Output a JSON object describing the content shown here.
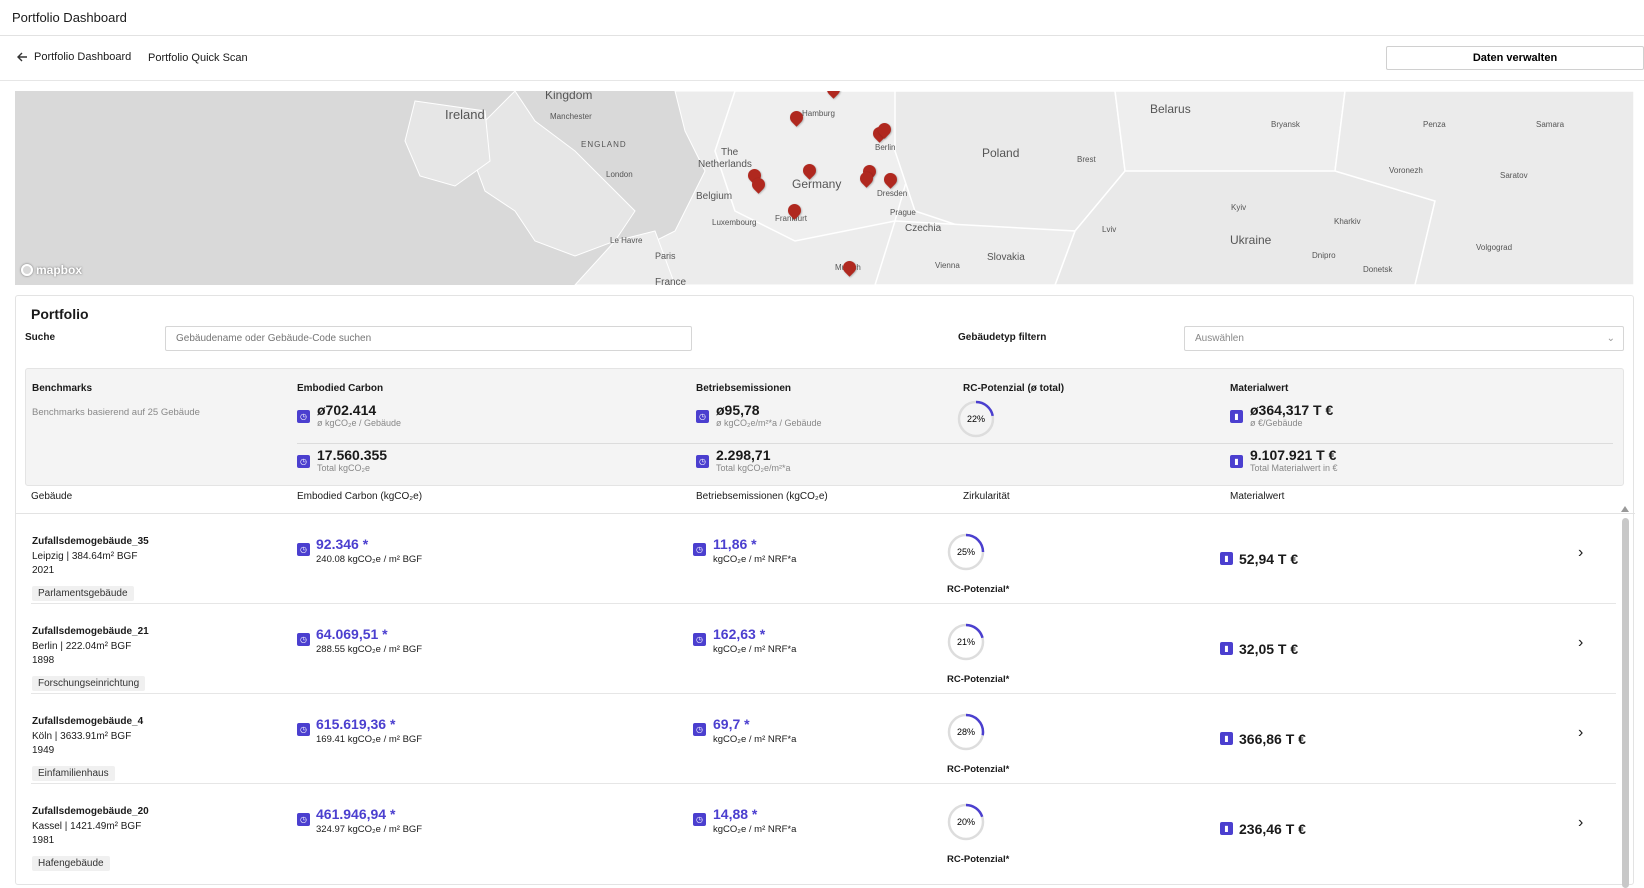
{
  "app": {
    "title": "Portfolio Dashboard"
  },
  "subnav": {
    "back_label": "Portfolio Dashboard",
    "quick_scan": "Portfolio Quick Scan",
    "manage_button": "Daten verwalten"
  },
  "map": {
    "labels": [
      {
        "text": "Kingdom",
        "size": "big"
      },
      {
        "text": "Ireland",
        "size": "big"
      },
      {
        "text": "Manchester",
        "size": "small"
      },
      {
        "text": "ENGLAND",
        "size": "small"
      },
      {
        "text": "London",
        "size": "small"
      },
      {
        "text": "The",
        "size": "mid"
      },
      {
        "text": "Netherlands",
        "size": "mid"
      },
      {
        "text": "Belgium",
        "size": "mid"
      },
      {
        "text": "Luxembourg",
        "size": "small"
      },
      {
        "text": "Le Havre",
        "size": "small"
      },
      {
        "text": "Paris",
        "size": "small"
      },
      {
        "text": "Germany",
        "size": "big"
      },
      {
        "text": "Hamburg",
        "size": "small"
      },
      {
        "text": "Berlin",
        "size": "small"
      },
      {
        "text": "Dresden",
        "size": "small"
      },
      {
        "text": "Frankfurt",
        "size": "small"
      },
      {
        "text": "Prague",
        "size": "small"
      },
      {
        "text": "Czechia",
        "size": "mid"
      },
      {
        "text": "Munich",
        "size": "small"
      },
      {
        "text": "Vienna",
        "size": "small"
      },
      {
        "text": "Slovakia",
        "size": "mid"
      },
      {
        "text": "Poland",
        "size": "big"
      },
      {
        "text": "Brest",
        "size": "small"
      },
      {
        "text": "Belarus",
        "size": "big"
      },
      {
        "text": "Bryansk",
        "size": "small"
      },
      {
        "text": "Penza",
        "size": "small"
      },
      {
        "text": "Samara",
        "size": "small"
      },
      {
        "text": "Voronezh",
        "size": "small"
      },
      {
        "text": "Saratov",
        "size": "small"
      },
      {
        "text": "Kyiv",
        "size": "small"
      },
      {
        "text": "Kharkiv",
        "size": "small"
      },
      {
        "text": "Ukraine",
        "size": "big"
      },
      {
        "text": "Volgograd",
        "size": "small"
      },
      {
        "text": "Dnipro",
        "size": "small"
      },
      {
        "text": "Donetsk",
        "size": "small"
      },
      {
        "text": "Lviv",
        "size": "small"
      },
      {
        "text": "France",
        "size": "mid"
      }
    ],
    "attribution": "mapbox"
  },
  "portfolio": {
    "title": "Portfolio",
    "search_label": "Suche",
    "search_placeholder": "Gebäudename oder Gebäude-Code suchen",
    "filter_label": "Gebäudetyp filtern",
    "filter_placeholder": "Auswählen"
  },
  "benchmarks": {
    "title": "Benchmarks",
    "subtitle": "Benchmarks basierend auf 25 Gebäude",
    "embodied": {
      "title": "Embodied Carbon",
      "avg_value": "ø702.414",
      "avg_caption": "ø kgCO₂e / Gebäude",
      "total_value": "17.560.355",
      "total_caption": "Total kgCO₂e"
    },
    "operational": {
      "title": "Betriebsemissionen",
      "avg_value": "ø95,78",
      "avg_caption": "ø kgCO₂e/m²*a / Gebäude",
      "total_value": "2.298,71",
      "total_caption": "Total kgCO₂e/m²*a"
    },
    "rc": {
      "title": "RC-Potenzial (ø total)",
      "value": "22%",
      "fraction": 0.22
    },
    "material": {
      "title": "Materialwert",
      "avg_value": "ø364,317 T €",
      "avg_caption": "ø €/Gebäude",
      "total_value": "9.107.921 T €",
      "total_caption": "Total Materialwert in €"
    }
  },
  "columns": [
    "Gebäude",
    "Embodied Carbon (kgCO₂e)",
    "Betriebsemissionen (kgCO₂e)",
    "Zirkularität",
    "Materialwert"
  ],
  "rows": [
    {
      "name": "Zufallsdemogebäude_35",
      "location": "Leipzig | 384.64m² BGF",
      "year": "2021",
      "tag": "Parlamentsgebäude",
      "ec_value": "92.346 *",
      "ec_sub": "240.08 kgCO₂e / m² BGF",
      "be_value": "11,86 *",
      "be_sub": "kgCO₂e / m² NRF*a",
      "rc_pct": "25%",
      "rc_fraction": 0.25,
      "rc_label": "RC-Potenzial*",
      "material": "52,94 T €"
    },
    {
      "name": "Zufallsdemogebäude_21",
      "location": "Berlin | 222.04m² BGF",
      "year": "1898",
      "tag": "Forschungseinrichtung",
      "ec_value": "64.069,51 *",
      "ec_sub": "288.55 kgCO₂e / m² BGF",
      "be_value": "162,63 *",
      "be_sub": "kgCO₂e / m² NRF*a",
      "rc_pct": "21%",
      "rc_fraction": 0.21,
      "rc_label": "RC-Potenzial*",
      "material": "32,05 T €"
    },
    {
      "name": "Zufallsdemogebäude_4",
      "location": "Köln | 3633.91m² BGF",
      "year": "1949",
      "tag": "Einfamilienhaus",
      "ec_value": "615.619,36 *",
      "ec_sub": "169.41 kgCO₂e / m² BGF",
      "be_value": "69,7 *",
      "be_sub": "kgCO₂e / m² NRF*a",
      "rc_pct": "28%",
      "rc_fraction": 0.28,
      "rc_label": "RC-Potenzial*",
      "material": "366,86 T €"
    },
    {
      "name": "Zufallsdemogebäude_20",
      "location": "Kassel | 1421.49m² BGF",
      "year": "1981",
      "tag": "Hafengebäude",
      "ec_value": "461.946,94 *",
      "ec_sub": "324.97 kgCO₂e / m² BGF",
      "be_value": "14,88 *",
      "be_sub": "kgCO₂e / m² NRF*a",
      "rc_pct": "20%",
      "rc_fraction": 0.2,
      "rc_label": "RC-Potenzial*",
      "material": "236,46 T €"
    }
  ],
  "colors": {
    "accent": "#4b3fcf",
    "pin": "#b0281f"
  }
}
